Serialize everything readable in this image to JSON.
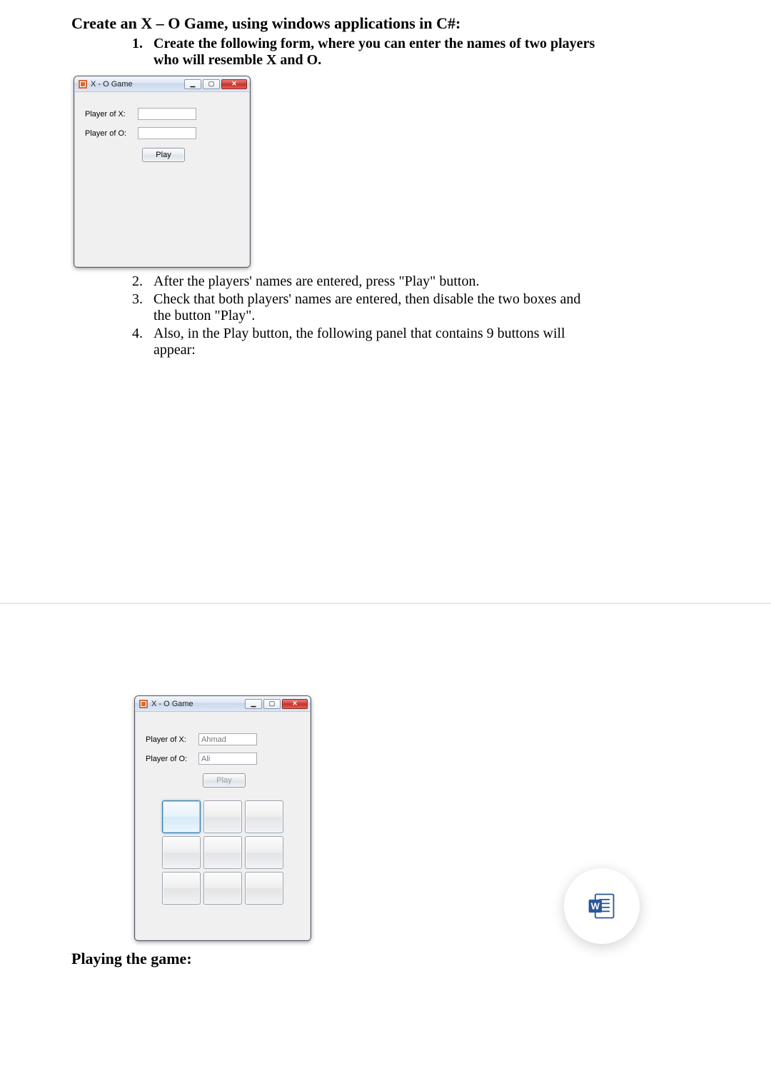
{
  "heading": "Create an X – O Game, using windows applications in C#:",
  "items": [
    "Create the following form, where you can enter the names of two players who will resemble X and O.",
    "After the players' names are entered, press \"Play\" button.",
    "Check that both players' names are entered, then disable the two boxes and the button \"Play\".",
    "Also, in the Play button, the following panel that contains 9 buttons will appear:"
  ],
  "form1": {
    "title": "X - O Game",
    "labelX": "Player of X:",
    "labelO": "Player of O:",
    "valueX": "",
    "valueO": "",
    "play": "Play"
  },
  "form2": {
    "title": "X - O Game",
    "labelX": "Player of X:",
    "labelO": "Player of O:",
    "valueX": "Ahmad",
    "valueO": "Ali",
    "play": "Play"
  },
  "subheading": "Playing the game:",
  "winbuttons": {
    "min": "▁",
    "max": "▢",
    "close": "✕"
  },
  "fab_letter": "W"
}
